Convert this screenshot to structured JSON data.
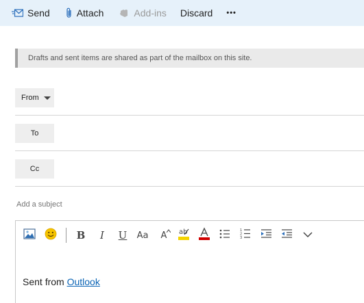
{
  "toolbar": {
    "send_label": "Send",
    "attach_label": "Attach",
    "addins_label": "Add-ins",
    "discard_label": "Discard",
    "more_label": "•••"
  },
  "banner": {
    "text": "Drafts and sent items are shared as part of the mailbox on this site."
  },
  "from": {
    "label": "From"
  },
  "to": {
    "label": "To"
  },
  "cc": {
    "label": "Cc"
  },
  "subject": {
    "placeholder": "Add a subject"
  },
  "editor": {
    "bold": "B",
    "italic": "I",
    "underline": "U",
    "font_size": "Aa",
    "grow_font": "A",
    "body_prefix": "Sent from ",
    "body_link": "Outlook"
  },
  "colors": {
    "command_bar": "#e6f1fa",
    "accent": "#0b64b5",
    "highlight": "#f4d300",
    "font_color": "#d00000"
  }
}
